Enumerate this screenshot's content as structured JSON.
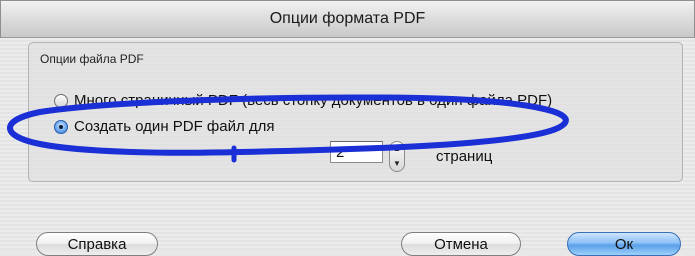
{
  "window": {
    "title": "Опции формата PDF"
  },
  "group": {
    "title": "Опции файла PDF"
  },
  "options": {
    "multi_page": {
      "label": "Много страничный PDF (весь стопку документов в один файла PDF)",
      "selected": false
    },
    "single_pdf": {
      "label": "Создать один PDF файл для",
      "selected": true
    }
  },
  "pages_per_file": {
    "value": "2",
    "suffix": "страниц"
  },
  "buttons": {
    "help": "Справка",
    "cancel": "Отмена",
    "ok": "Ок"
  },
  "colors": {
    "annotation": "#1a2fd6",
    "default_button": "#5a9fe8"
  }
}
